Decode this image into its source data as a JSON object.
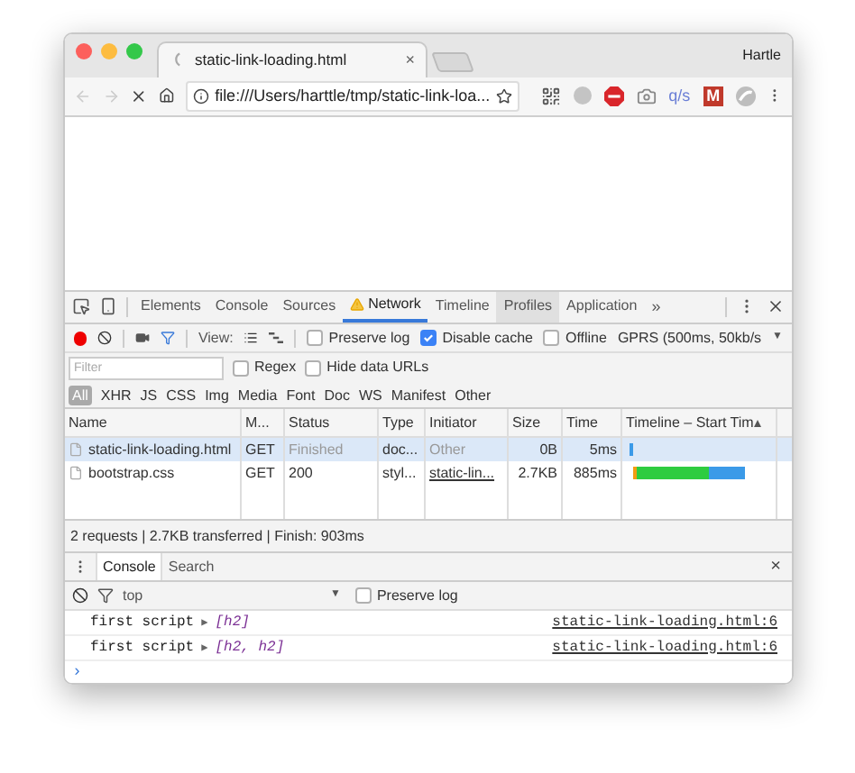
{
  "browser": {
    "tab": {
      "title": "static-link-loading.html",
      "close": "×"
    },
    "profile": "Hartle",
    "back_disabled": true,
    "forward_disabled": true,
    "url": "file:///Users/harttle/tmp/static-link-loa...",
    "extensions": [
      {
        "kind": "qr"
      },
      {
        "kind": "dot"
      },
      {
        "kind": "stop"
      },
      {
        "kind": "camera"
      },
      {
        "kind": "text",
        "label": "q/s"
      },
      {
        "kind": "badge",
        "label": "M"
      },
      {
        "kind": "swirl"
      }
    ]
  },
  "devtools": {
    "tabs": [
      {
        "label": "Elements",
        "selected": false,
        "hovered": false,
        "warning": false
      },
      {
        "label": "Console",
        "selected": false,
        "hovered": false,
        "warning": false
      },
      {
        "label": "Sources",
        "selected": false,
        "hovered": false,
        "warning": false
      },
      {
        "label": "Network",
        "selected": true,
        "hovered": false,
        "warning": true
      },
      {
        "label": "Timeline",
        "selected": false,
        "hovered": false,
        "warning": false
      },
      {
        "label": "Profiles",
        "selected": false,
        "hovered": true,
        "warning": false
      },
      {
        "label": "Application",
        "selected": false,
        "hovered": false,
        "warning": false
      }
    ],
    "more": "»",
    "toolbar": {
      "recording": true,
      "filter_on": true,
      "view_label": "View:",
      "checkboxes": [
        {
          "label": "Preserve log",
          "checked": false
        },
        {
          "label": "Disable cache",
          "checked": true
        },
        {
          "label": "Offline",
          "checked": false
        }
      ],
      "throttle": "GPRS (500ms, 50kb/s",
      "throttle_arrow": "▼"
    },
    "filter": {
      "placeholder": "Filter",
      "checkboxes": [
        {
          "label": "Regex",
          "checked": false
        },
        {
          "label": "Hide data URLs",
          "checked": false
        }
      ]
    },
    "types": [
      {
        "label": "All",
        "selected": true
      },
      {
        "label": "XHR",
        "selected": false
      },
      {
        "label": "JS",
        "selected": false
      },
      {
        "label": "CSS",
        "selected": false
      },
      {
        "label": "Img",
        "selected": false
      },
      {
        "label": "Media",
        "selected": false
      },
      {
        "label": "Font",
        "selected": false
      },
      {
        "label": "Doc",
        "selected": false
      },
      {
        "label": "WS",
        "selected": false
      },
      {
        "label": "Manifest",
        "selected": false
      },
      {
        "label": "Other",
        "selected": false
      }
    ],
    "table": {
      "columns": [
        "Name",
        "M...",
        "Status",
        "Type",
        "Initiator",
        "Size",
        "Time",
        "Timeline – Start Tim"
      ],
      "rows": [
        {
          "name": "static-link-loading.html",
          "method": "GET",
          "status": "Finished",
          "type": "doc...",
          "initiator": "Other",
          "size": "0B",
          "time": "5ms",
          "dimmed": true,
          "initiator_link": false,
          "selected": true,
          "full_bar": false
        },
        {
          "name": "bootstrap.css",
          "method": "GET",
          "status": "200",
          "type": "styl...",
          "initiator": "static-lin...",
          "size": "2.7KB",
          "time": "885ms",
          "dimmed": false,
          "initiator_link": true,
          "selected": false,
          "full_bar": true
        }
      ]
    },
    "status_bar": "2 requests | 2.7KB transferred | Finish: 903ms",
    "drawer": {
      "tabs": [
        {
          "label": "Console",
          "selected": true
        },
        {
          "label": "Search",
          "selected": false
        }
      ],
      "close": "×",
      "context": "top",
      "context_arrow": "▼",
      "preserve": {
        "label": "Preserve log",
        "checked": false
      },
      "messages": [
        {
          "text": "first script",
          "arrow": "▶",
          "preview": "[h2]",
          "source": "static-link-loading.html:6"
        },
        {
          "text": "first script",
          "arrow": "▶",
          "preview": "[h2, h2]",
          "source": "static-link-loading.html:6"
        }
      ],
      "prompt": "›"
    }
  }
}
